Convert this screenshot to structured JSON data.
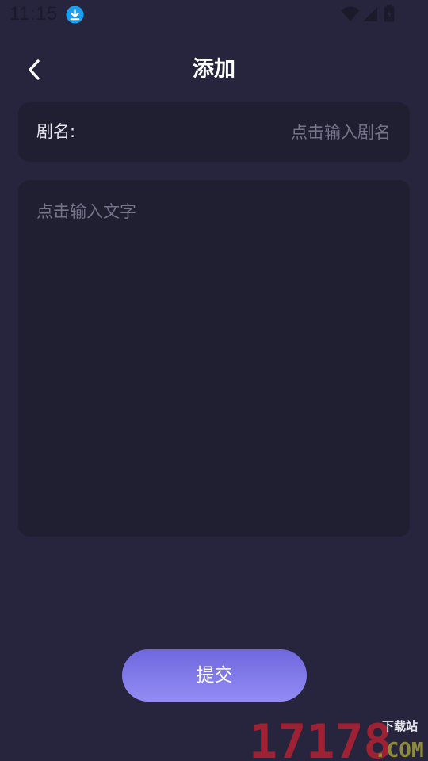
{
  "status_bar": {
    "time": "11:15",
    "icons": [
      "download-icon",
      "wifi-icon",
      "signal-icon",
      "battery-icon"
    ]
  },
  "header": {
    "back_icon": "chevron-left-icon",
    "title": "添加"
  },
  "form": {
    "name_label": "剧名:",
    "name_placeholder": "点击输入剧名",
    "name_value": "",
    "content_placeholder": "点击输入文字",
    "content_value": ""
  },
  "submit": {
    "label": "提交"
  },
  "watermark": {
    "number": "17178",
    "tag": "下载站",
    "domain": ".COM"
  },
  "colors": {
    "background": "#27253e",
    "card": "#201f31",
    "placeholder": "#74738a",
    "button_gradient_top": "#6f67dd",
    "button_gradient_bottom": "#938cf4",
    "status_download_badge": "#1aa0f0"
  }
}
